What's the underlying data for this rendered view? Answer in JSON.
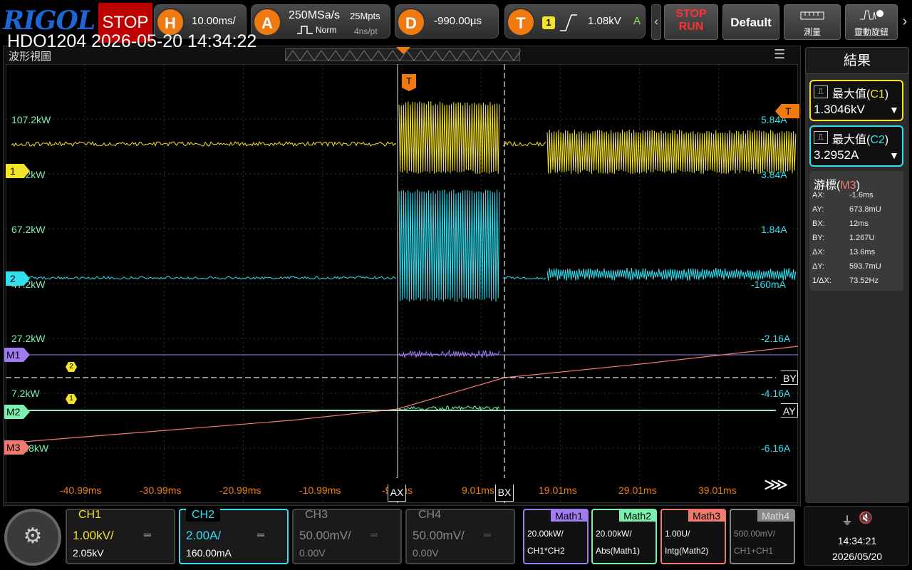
{
  "brand": "RIGOL",
  "status": "STOP",
  "horizontal": {
    "key": "H",
    "timebase": "10.00ms/"
  },
  "acquire": {
    "key": "A",
    "sample_rate": "250MSa/s",
    "memory": "25Mpts",
    "mode": "Norm",
    "interval": "4ns/pt"
  },
  "delay": {
    "key": "D",
    "value": "-990.00µs"
  },
  "trigger": {
    "key": "T",
    "source": "1",
    "level": "1.08kV",
    "mode": "A"
  },
  "buttons": {
    "stop": "STOP",
    "run": "RUN",
    "default": "Default",
    "measure": "測量",
    "auto": "靈動旋鈕"
  },
  "timestamp": "HDO1204 2026-05-20 14:34:22",
  "view_title": "波形視圖",
  "left_scale": [
    "107.2kW",
    "87.2kW",
    "67.2kW",
    "47.2kW",
    "27.2kW",
    "7.2kW",
    "-12.8kW"
  ],
  "right_scale": [
    "5.84A",
    "3.84A",
    "1.84A",
    "-160mA",
    "-2.16A",
    "-4.16A",
    "-6.16A"
  ],
  "time_ticks": [
    "-40.99ms",
    "-30.99ms",
    "-20.99ms",
    "-10.99ms",
    "-990µs",
    "9.01ms",
    "19.01ms",
    "29.01ms",
    "39.01ms"
  ],
  "markers": {
    "ch1": "1",
    "ch2": "2",
    "m1": "M1",
    "m2": "M2",
    "m3": "M3",
    "trig": "T",
    "ax": "AX",
    "bx": "BX",
    "ay": "AY",
    "by": "BY"
  },
  "results": {
    "title": "結果",
    "meas1": {
      "label": "最大值",
      "src": "C1",
      "value": "1.3046kV"
    },
    "meas2": {
      "label": "最大值",
      "src": "C2",
      "value": "3.2952A"
    },
    "cursor": {
      "label": "游標",
      "src": "M3",
      "rows": [
        [
          "AX:",
          "-1.6ms"
        ],
        [
          "AY:",
          "673.8mU"
        ],
        [
          "BX:",
          "12ms"
        ],
        [
          "BY:",
          "1.267U"
        ],
        [
          "ΔX:",
          "13.6ms"
        ],
        [
          "ΔY:",
          "593.7mU"
        ],
        [
          "1/ΔX:",
          "73.52Hz"
        ]
      ]
    }
  },
  "channels": [
    {
      "name": "CH1",
      "scale": "1.00kV/",
      "offset": "2.05kV",
      "color": "#f5e32a"
    },
    {
      "name": "CH2",
      "scale": "2.00A/",
      "offset": "160.00mA",
      "color": "#30e0f0"
    },
    {
      "name": "CH3",
      "scale": "50.00mV/",
      "offset": "0.00V",
      "color": "#888888"
    },
    {
      "name": "CH4",
      "scale": "50.00mV/",
      "offset": "0.00V",
      "color": "#888888"
    }
  ],
  "maths": [
    {
      "name": "Math1",
      "scale": "20.00kW/",
      "expr": "CH1*CH2",
      "color": "#a07cf0"
    },
    {
      "name": "Math2",
      "scale": "20.00kW/",
      "expr": "Abs(Math1)",
      "color": "#7cf0b0"
    },
    {
      "name": "Math3",
      "scale": "1.00U/",
      "expr": "Intg(Math2)",
      "color": "#f07a70"
    },
    {
      "name": "Math4",
      "scale": "500.00mV/",
      "expr": "CH1+CH1",
      "color": "#888888"
    }
  ],
  "clock": {
    "time": "14:34:21",
    "date": "2026/05/20"
  }
}
